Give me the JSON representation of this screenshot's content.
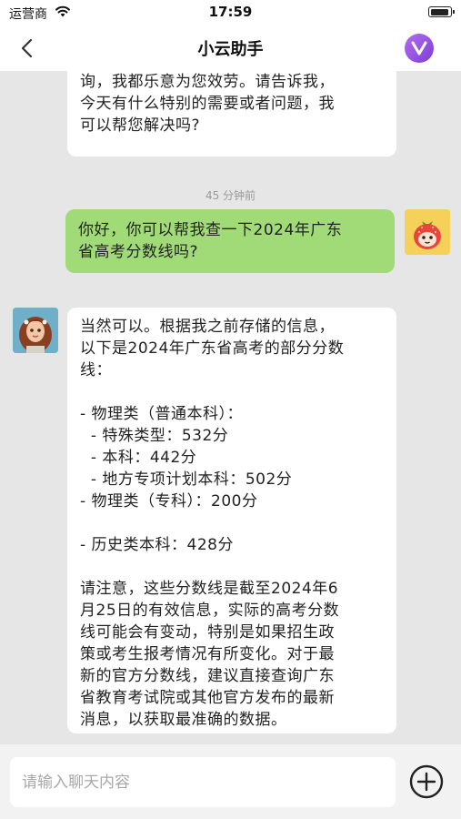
{
  "status_bar": {
    "carrier": "运营商",
    "time": "17:59",
    "wifi_icon": "wifi-icon",
    "battery_icon": "battery-icon"
  },
  "nav": {
    "title": "小云助手",
    "back_icon": "chevron-left-icon",
    "vip_icon": "vip-badge-icon",
    "vip_letter": "V",
    "vip_color": "#9b59e6"
  },
  "messages": [
    {
      "role": "assistant",
      "text": "分析、任务规划，还是简单的日常咨\n询，我都乐意为您效劳。请告诉我，\n今天有什么特别的需要或者问题，我\n可以帮您解决吗?"
    },
    {
      "role": "timestamp",
      "text": "45 分钟前"
    },
    {
      "role": "user",
      "text": "你好，你可以帮我查一下2024年广东\n省高考分数线吗?"
    },
    {
      "role": "assistant",
      "text": "当然可以。根据我之前存储的信息，\n以下是2024年广东省高考的部分分数\n线：\n\n- 物理类（普通本科）：\n  - 特殊类型：532分\n  - 本科：442分\n  - 地方专项计划本科：502分\n- 物理类（专科）：200分\n\n- 历史类本科：428分\n\n请注意，这些分数线是截至2024年6\n月25日的有效信息，实际的高考分数\n线可能会有变动，特别是如果招生政\n策或考生报考情况有所变化。对于最\n新的官方分数线，建议直接查询广东\n省教育考试院或其他官方发布的最新\n消息，以获取最准确的数据。"
    }
  ],
  "input": {
    "placeholder": "请输入聊天内容",
    "value": "",
    "add_icon": "plus-circle-icon"
  },
  "colors": {
    "user_bubble": "#a1db78",
    "assistant_bubble": "#ffffff",
    "background": "#e6e6e6"
  }
}
